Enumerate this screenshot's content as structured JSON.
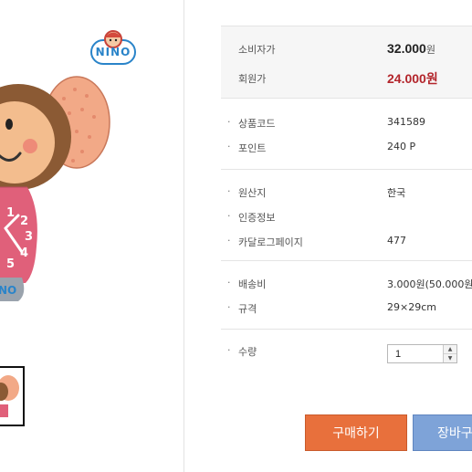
{
  "brand": {
    "logo_text": "NINO"
  },
  "product_image": {
    "clock_numbers": [
      "1",
      "2",
      "3",
      "4",
      "5"
    ]
  },
  "price_box": {
    "consumer_price_label": "소비자가",
    "consumer_price_value": "32.000",
    "consumer_price_unit": "원",
    "member_price_label": "회원가",
    "member_price_value": "24.000원"
  },
  "details": {
    "product_code_label": "상품코드",
    "product_code_value": "341589",
    "points_label": "포인트",
    "points_value": "240 P",
    "origin_label": "원산지",
    "origin_value": "한국",
    "certification_label": "인증정보",
    "catalog_label": "카달로그페이지",
    "catalog_value": "477",
    "shipping_label": "배송비",
    "shipping_value": "3.000원(50.000원 이",
    "size_label": "규격",
    "size_value": "29×29cm",
    "quantity_label": "수량",
    "quantity_value": "1"
  },
  "buttons": {
    "buy_label": "구매하기",
    "cart_label": "장바구"
  },
  "colors": {
    "buy_button": "#e8703c",
    "cart_button": "#7ea3d8",
    "member_price": "#b3252b",
    "brand_logo": "#2a84c9"
  },
  "icons": [
    "nino-logo",
    "monkey-clock-image",
    "thumbnail-image",
    "stepper-up-icon",
    "stepper-down-icon"
  ]
}
